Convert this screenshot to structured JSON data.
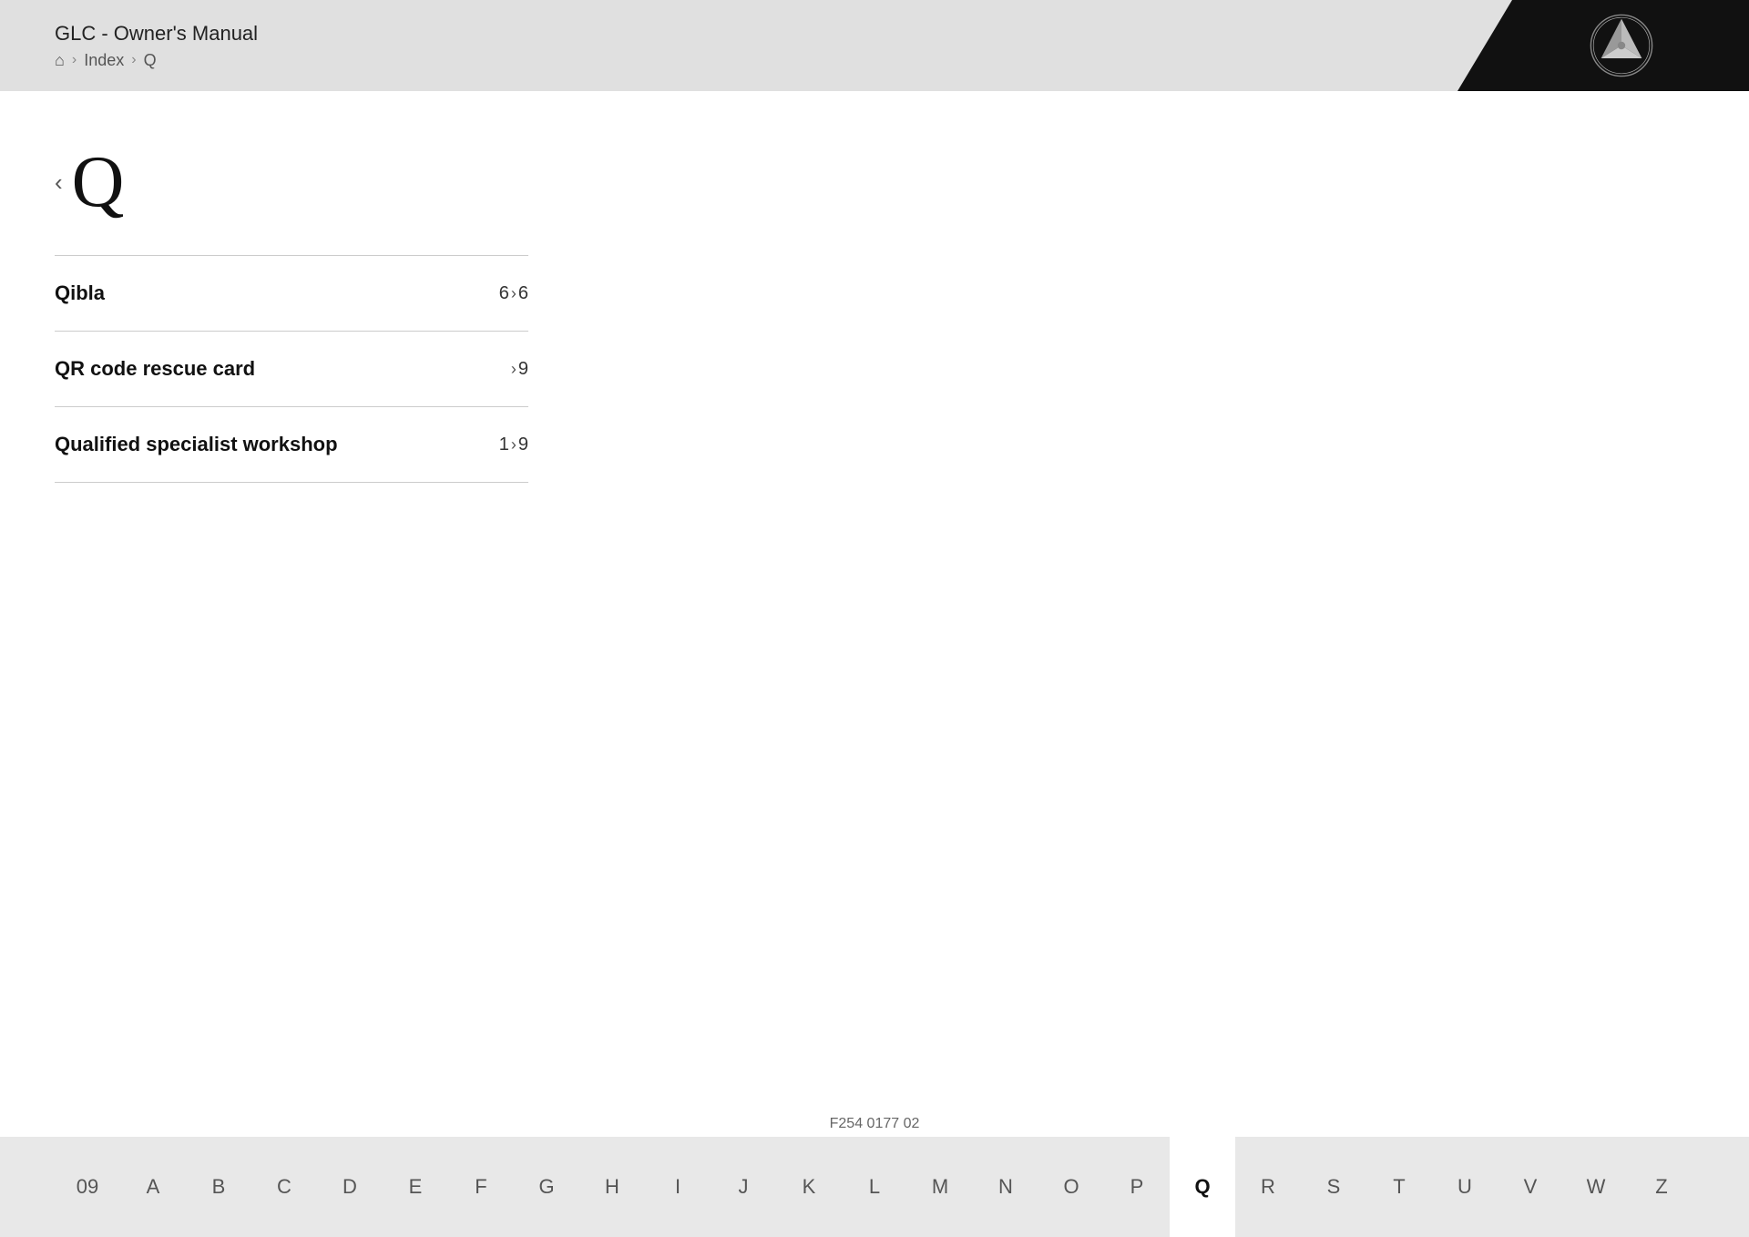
{
  "header": {
    "title": "GLC - Owner's Manual",
    "breadcrumb": {
      "home_label": "home",
      "index_label": "Index",
      "current_label": "Q",
      "sep": "›"
    }
  },
  "logo": {
    "alt": "Mercedes-Benz"
  },
  "section": {
    "letter": "Q",
    "prev_arrow": "‹"
  },
  "index_items": [
    {
      "label": "Qibla",
      "page_prefix": "6",
      "page_arrow": "›",
      "page_suffix": "6"
    },
    {
      "label": "QR code rescue card",
      "page_prefix": "",
      "page_arrow": "›",
      "page_suffix": "9"
    },
    {
      "label": "Qualified specialist workshop",
      "page_prefix": "1",
      "page_arrow": "›",
      "page_suffix": "9"
    }
  ],
  "alphabet": [
    "09",
    "A",
    "B",
    "C",
    "D",
    "E",
    "F",
    "G",
    "H",
    "I",
    "J",
    "K",
    "L",
    "M",
    "N",
    "O",
    "P",
    "Q",
    "R",
    "S",
    "T",
    "U",
    "V",
    "W",
    "Z"
  ],
  "active_letter": "Q",
  "doc_number": "F254 0177 02"
}
